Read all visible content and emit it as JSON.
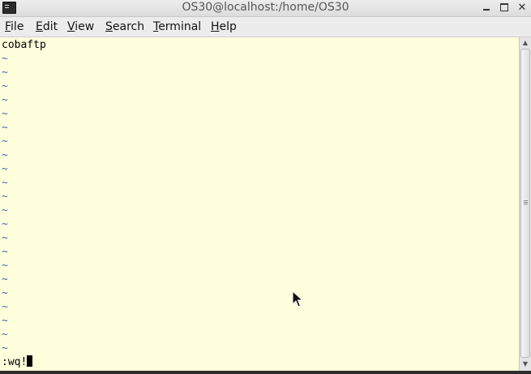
{
  "window": {
    "title": "OS30@localhost:/home/OS30"
  },
  "menubar": {
    "items": [
      {
        "label_mnemonic": "F",
        "label_rest": "ile"
      },
      {
        "label_mnemonic": "E",
        "label_rest": "dit"
      },
      {
        "label_mnemonic": "V",
        "label_rest": "iew"
      },
      {
        "label_mnemonic": "S",
        "label_rest": "earch"
      },
      {
        "label_mnemonic": "T",
        "label_rest": "erminal"
      },
      {
        "label_mnemonic": "H",
        "label_rest": "elp"
      }
    ]
  },
  "terminal": {
    "first_line": "cobaftp",
    "empty_line_marker": "~",
    "command_line": ":wq!"
  },
  "colors": {
    "terminal_background": "#ffffdd",
    "tilde": "#3a6ea5"
  }
}
